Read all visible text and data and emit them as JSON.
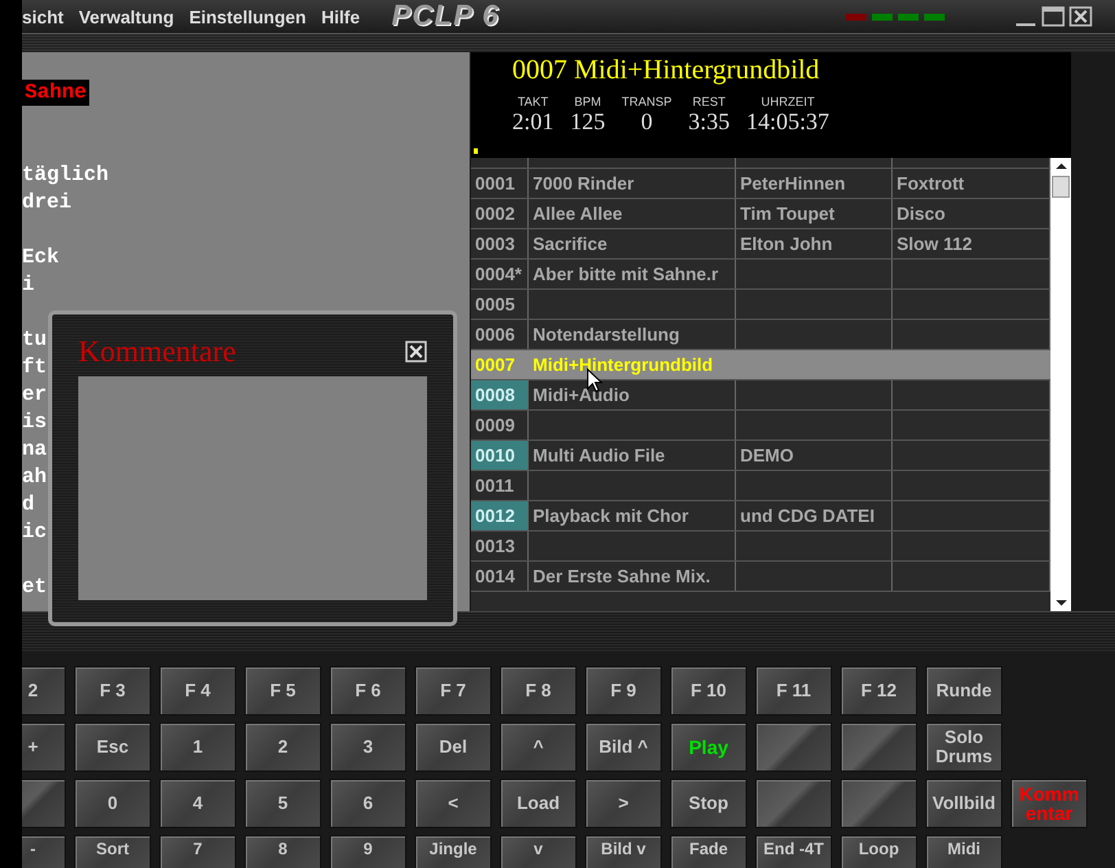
{
  "menu": [
    "sicht",
    "Verwaltung",
    "Einstellungen",
    "Hilfe"
  ],
  "logo": "PCLP 6",
  "leds": [
    {
      "color": "#800000"
    },
    {
      "color": "#008000"
    },
    {
      "color": "#008000"
    },
    {
      "color": "#008000"
    }
  ],
  "lyrics": [
    {
      "kind": "highlight",
      "text": "Sahne"
    },
    {
      "kind": "blank"
    },
    {
      "kind": "blank"
    },
    {
      "kind": "line",
      "text": "täglich"
    },
    {
      "kind": "line",
      "text": "drei"
    },
    {
      "kind": "blank"
    },
    {
      "kind": "line",
      "text": "Eck"
    },
    {
      "kind": "line",
      "text": "i"
    },
    {
      "kind": "blank"
    },
    {
      "kind": "line",
      "text": "tu"
    },
    {
      "kind": "line",
      "text": "ft"
    },
    {
      "kind": "line",
      "text": "er"
    },
    {
      "kind": "line",
      "text": "is"
    },
    {
      "kind": "line",
      "text": "na"
    },
    {
      "kind": "line",
      "text": "ah"
    },
    {
      "kind": "line",
      "text": "d"
    },
    {
      "kind": "line",
      "text": "ic"
    },
    {
      "kind": "blank"
    },
    {
      "kind": "line",
      "text": "et"
    }
  ],
  "now_playing": {
    "title": "0007  Midi+Hintergrundbild",
    "stats": [
      {
        "label": "TAKT",
        "value": "2:01"
      },
      {
        "label": "BPM",
        "value": "125"
      },
      {
        "label": "TRANSP",
        "value": "0"
      },
      {
        "label": "REST",
        "value": "3:35"
      },
      {
        "label": "UHRZEIT",
        "value": "14:05:37"
      }
    ]
  },
  "table": {
    "rows": [
      {
        "number": "0001",
        "cells": [
          "7000 Rinder",
          "PeterHinnen",
          "Foxtrott"
        ],
        "selected": false,
        "marked": false
      },
      {
        "number": "0002",
        "cells": [
          "Allee Allee",
          "Tim Toupet",
          "Disco"
        ],
        "selected": false,
        "marked": false
      },
      {
        "number": "0003",
        "cells": [
          "Sacrifice",
          "Elton John",
          "Slow 112"
        ],
        "selected": false,
        "marked": false
      },
      {
        "number": "0004*",
        "cells": [
          "Aber bitte mit Sahne.r"
        ],
        "selected": false,
        "marked": false
      },
      {
        "number": "0005",
        "cells": [],
        "selected": false,
        "marked": false
      },
      {
        "number": "0006",
        "cells": [
          "Notendarstellung"
        ],
        "selected": false,
        "marked": false
      },
      {
        "number": "0007",
        "cells": [
          "Midi+Hintergrundbild"
        ],
        "selected": true,
        "marked": false
      },
      {
        "number": "0008",
        "cells": [
          "Midi+Audio"
        ],
        "selected": false,
        "marked": true
      },
      {
        "number": "0009",
        "cells": [],
        "selected": false,
        "marked": false
      },
      {
        "number": "0010",
        "cells": [
          "Multi Audio File",
          "DEMO"
        ],
        "selected": false,
        "marked": true
      },
      {
        "number": "0011",
        "cells": [],
        "selected": false,
        "marked": false
      },
      {
        "number": "0012",
        "cells": [
          "Playback mit Chor",
          "und CDG DATEI"
        ],
        "selected": false,
        "marked": true
      },
      {
        "number": "0013",
        "cells": [],
        "selected": false,
        "marked": false
      },
      {
        "number": "0014",
        "cells": [
          "Der Erste Sahne Mix."
        ],
        "selected": false,
        "marked": false
      }
    ]
  },
  "comment_dialog": {
    "title": "Kommentare"
  },
  "keys": [
    [
      {
        "label": "2"
      },
      {
        "label": "F 3"
      },
      {
        "label": "F 4"
      },
      {
        "label": "F 5"
      },
      {
        "label": "F 6"
      },
      {
        "label": "F 7"
      },
      {
        "label": "F 8"
      },
      {
        "label": "F 9"
      },
      {
        "label": "F 10"
      },
      {
        "label": "F 11"
      },
      {
        "label": "F 12"
      },
      {
        "label": "Runde"
      }
    ],
    [
      {
        "label": "+"
      },
      {
        "label": "Esc"
      },
      {
        "label": "1"
      },
      {
        "label": "2"
      },
      {
        "label": "3"
      },
      {
        "label": "Del"
      },
      {
        "label": "^"
      },
      {
        "label": "Bild ^"
      },
      {
        "label": "Play",
        "playing": true
      },
      {
        "kind": "blank"
      },
      {
        "kind": "blank"
      },
      {
        "label": "Solo Drums"
      }
    ],
    [
      {
        "kind": "blank"
      },
      {
        "label": "0"
      },
      {
        "label": "4"
      },
      {
        "label": "5"
      },
      {
        "label": "6"
      },
      {
        "label": "<"
      },
      {
        "label": "Load"
      },
      {
        "label": ">"
      },
      {
        "label": "Stop"
      },
      {
        "kind": "blank"
      },
      {
        "kind": "blank"
      },
      {
        "label": "Vollbild"
      },
      {
        "label": "Komm entar",
        "alert": true
      }
    ],
    [
      {
        "label": "-"
      },
      {
        "label": "Sort"
      },
      {
        "label": "7"
      },
      {
        "label": "8"
      },
      {
        "label": "9"
      },
      {
        "label": "Jingle"
      },
      {
        "label": "v"
      },
      {
        "label": "Bild v"
      },
      {
        "label": "Fade"
      },
      {
        "label": "End -4T"
      },
      {
        "label": "Loop"
      },
      {
        "label": "Midi"
      }
    ]
  ]
}
